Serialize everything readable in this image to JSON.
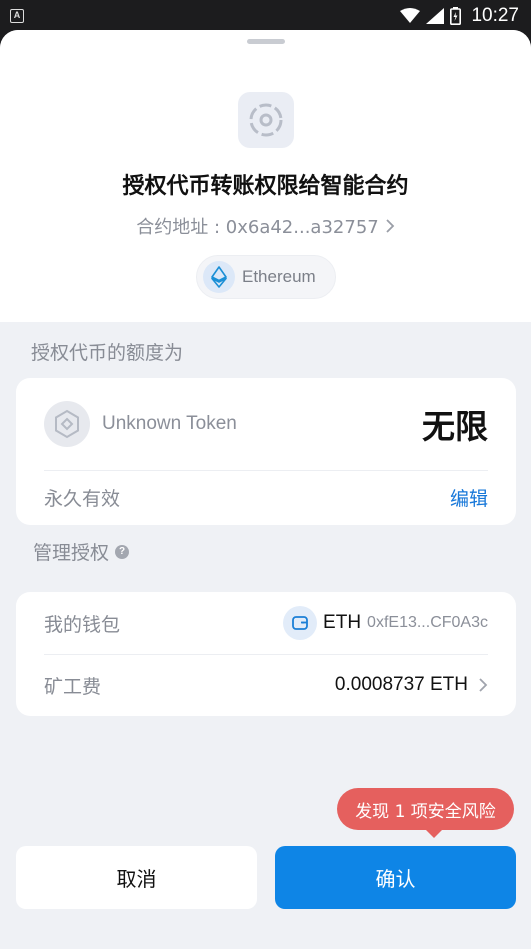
{
  "status_bar": {
    "time": "10:27",
    "notification_label": "A"
  },
  "header": {
    "title": "授权代币转账权限给智能合约",
    "address_label": "合约地址 : 0x6a42...a32757",
    "chain_name": "Ethereum"
  },
  "allowance": {
    "section_label": "授权代币的额度为",
    "token_name": "Unknown Token",
    "amount": "无限",
    "validity": "永久有效",
    "edit_label": "编辑"
  },
  "manage": {
    "section_label": "管理授权",
    "help_icon": "?",
    "wallet_label": "我的钱包",
    "wallet_coin": "ETH",
    "wallet_address": "0xfE13...CF0A3c",
    "fee_label": "矿工费",
    "fee_value": "0.0008737 ETH"
  },
  "risk": {
    "label": "发现 1 项安全风险",
    "color": "#e5605e"
  },
  "actions": {
    "cancel_label": "取消",
    "confirm_label": "确认"
  },
  "colors": {
    "accent": "#0e85e6",
    "link": "#1677d9",
    "background": "#eff1f5"
  }
}
